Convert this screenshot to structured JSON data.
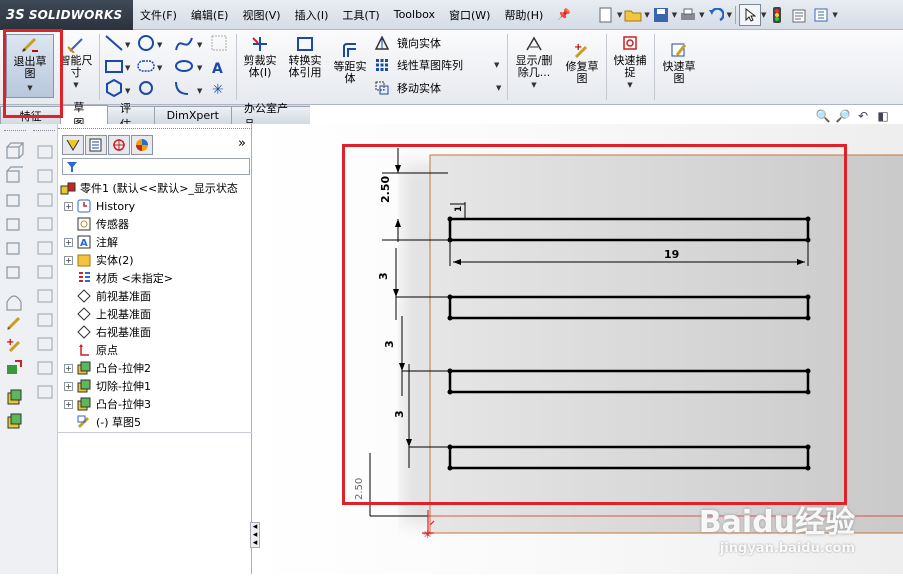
{
  "app": {
    "brand": "SOLIDWORKS",
    "ds_mark": "3S"
  },
  "menu": [
    "文件(F)",
    "编辑(E)",
    "视图(V)",
    "插入(I)",
    "工具(T)",
    "Toolbox",
    "窗口(W)",
    "帮助(H)"
  ],
  "ribbon": {
    "exit_sketch": "退出草\n图",
    "smart_dim": "智能尺\n寸",
    "trim": "剪裁实\n体(I)",
    "convert": "转换实\n体引用",
    "offset": "等距实\n体",
    "mirror": "镜向实体",
    "linear_pattern": "线性草图阵列",
    "move": "移动实体",
    "show_delete": "显示/删\n除几...",
    "repair": "修复草\n图",
    "quick_snap": "快速捕\n捉",
    "rapid_sketch": "快速草\n图"
  },
  "tabs": [
    "特征",
    "草图",
    "评估",
    "DimXpert",
    "办公室产品"
  ],
  "feature_tree": {
    "root": "零件1 (默认<<默认>_显示状态",
    "items": [
      {
        "label": "History",
        "expander": "+"
      },
      {
        "label": "传感器",
        "expander": ""
      },
      {
        "label": "注解",
        "expander": "+"
      },
      {
        "label": "实体(2)",
        "expander": "+"
      },
      {
        "label": "材质 <未指定>",
        "expander": ""
      },
      {
        "label": "前视基准面",
        "expander": ""
      },
      {
        "label": "上视基准面",
        "expander": ""
      },
      {
        "label": "右视基准面",
        "expander": ""
      },
      {
        "label": "原点",
        "expander": ""
      },
      {
        "label": "凸台-拉伸2",
        "expander": "+"
      },
      {
        "label": "切除-拉伸1",
        "expander": "+"
      },
      {
        "label": "凸台-拉伸3",
        "expander": "+"
      },
      {
        "label": "(-) 草图5",
        "expander": ""
      }
    ]
  },
  "sketch": {
    "dims": {
      "top": "2.50",
      "width": "19",
      "gap1": "3",
      "gap2": "3",
      "gap3": "3",
      "bottom": "2.50",
      "small": "1"
    }
  },
  "fm_expand": "»",
  "watermark": {
    "main": "Baidu经验",
    "sub": "jingyan.baidu.com"
  },
  "colors": {
    "highlight": "#e02127",
    "plane_edge": "#c0783a"
  }
}
